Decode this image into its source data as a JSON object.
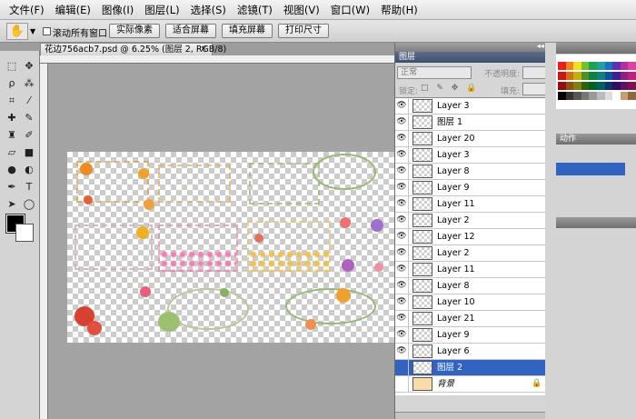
{
  "menu": [
    "文件(F)",
    "编辑(E)",
    "图像(I)",
    "图层(L)",
    "选择(S)",
    "滤镜(T)",
    "视图(V)",
    "窗口(W)",
    "帮助(H)"
  ],
  "options": {
    "scroll_all_label": "滚动所有窗口",
    "actual_pixels": "实际像素",
    "fit_screen": "适合屏幕",
    "fill_screen": "填充屏幕",
    "print_size": "打印尺寸"
  },
  "document": {
    "tab_title": "花边756acb7.psd @ 6.25% (图层 2, RGB/8)",
    "close": "×"
  },
  "layers_panel": {
    "tab": "图层",
    "menu_icon": "≡",
    "blend_mode": "正常",
    "opacity_label": "不透明度:",
    "lock_label": "锁定:",
    "lock_icons": "□ ✎ ✥ 🔒",
    "fill_label": "填充:",
    "layers": [
      {
        "name": "Layer 3",
        "visible": true,
        "selected": false
      },
      {
        "name": "图层 1",
        "visible": true,
        "selected": false
      },
      {
        "name": "Layer 20",
        "visible": true,
        "selected": false
      },
      {
        "name": "Layer 3",
        "visible": true,
        "selected": false
      },
      {
        "name": "Layer 8",
        "visible": true,
        "selected": false
      },
      {
        "name": "Layer 9",
        "visible": true,
        "selected": false
      },
      {
        "name": "Layer 11",
        "visible": true,
        "selected": false
      },
      {
        "name": "Layer 2",
        "visible": true,
        "selected": false
      },
      {
        "name": "Layer 12",
        "visible": true,
        "selected": false
      },
      {
        "name": "Layer 2",
        "visible": true,
        "selected": false
      },
      {
        "name": "Layer 11",
        "visible": true,
        "selected": false
      },
      {
        "name": "Layer 8",
        "visible": true,
        "selected": false
      },
      {
        "name": "Layer 10",
        "visible": true,
        "selected": false
      },
      {
        "name": "Layer 21",
        "visible": true,
        "selected": false
      },
      {
        "name": "Layer 9",
        "visible": true,
        "selected": false
      },
      {
        "name": "Layer 6",
        "visible": true,
        "selected": false
      },
      {
        "name": "图层 2",
        "visible": false,
        "selected": true
      },
      {
        "name": "背景",
        "visible": false,
        "selected": false,
        "background": true
      }
    ]
  },
  "side_panels": {
    "actions_tab": "动作"
  },
  "icons": {
    "hand": "hand-icon",
    "eye": "eye-icon",
    "lock": "lock-icon"
  },
  "colors": {
    "selection": "#3163c1",
    "foreground": "#000000",
    "background": "#ffffff",
    "panel_header": "#3c4f6c"
  }
}
